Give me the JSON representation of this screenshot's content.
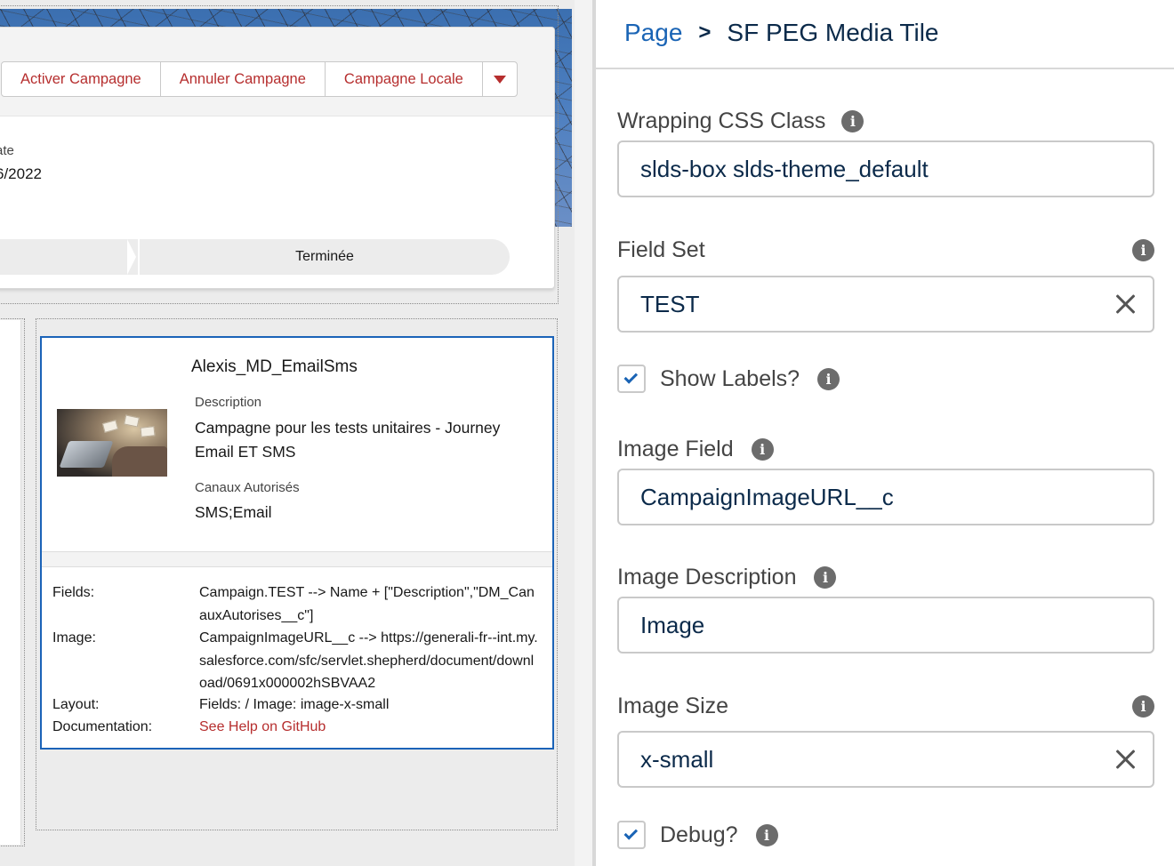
{
  "canvas": {
    "header": {
      "buttons": [
        "Activer Campagne",
        "Annuler Campagne",
        "Campagne Locale"
      ],
      "date_label": "ate",
      "date_value": "6/2022",
      "path_current_step": "Terminée"
    },
    "tile": {
      "title": "Alexis_MD_EmailSms",
      "fields": [
        {
          "label": "Description",
          "value": "Campagne pour les tests unitaires - Journey Email ET SMS"
        },
        {
          "label": "Canaux Autorisés",
          "value": "SMS;Email"
        }
      ],
      "debug": {
        "fields_label": "Fields:",
        "fields_value": "Campaign.TEST --> Name + [\"Description\",\"DM_CanauxAutorises__c\"]",
        "image_label": "Image:",
        "image_value": "CampaignImageURL__c --> https://generali-fr--int.my.salesforce.com/sfc/servlet.shepherd/document/download/0691x000002hSBVAA2",
        "layout_label": "Layout:",
        "layout_value": "Fields: / Image: image-x-small",
        "documentation_label": "Documentation:",
        "documentation_link": "See Help on GitHub"
      }
    }
  },
  "panel": {
    "breadcrumb": {
      "parent": "Page",
      "separator": ">",
      "current": "SF PEG Media Tile"
    },
    "wrapping_css": {
      "label": "Wrapping CSS Class",
      "value": "slds-box slds-theme_default"
    },
    "field_set": {
      "label": "Field Set",
      "value": "TEST"
    },
    "show_labels": {
      "label": "Show Labels?",
      "checked": true
    },
    "image_field": {
      "label": "Image Field",
      "value": "CampaignImageURL__c"
    },
    "image_description": {
      "label": "Image Description",
      "value": "Image"
    },
    "image_size": {
      "label": "Image Size",
      "value": "x-small"
    },
    "debug": {
      "label": "Debug?",
      "checked": true
    }
  },
  "colors": {
    "link_red": "#b62e2e",
    "brand_blue": "#1a64b5",
    "tile_border": "#1b63b8",
    "text_navy": "#0b2a4a"
  },
  "icons": [
    "chevron-down-icon",
    "info-icon",
    "clear-icon",
    "checkbox-checked-icon"
  ]
}
